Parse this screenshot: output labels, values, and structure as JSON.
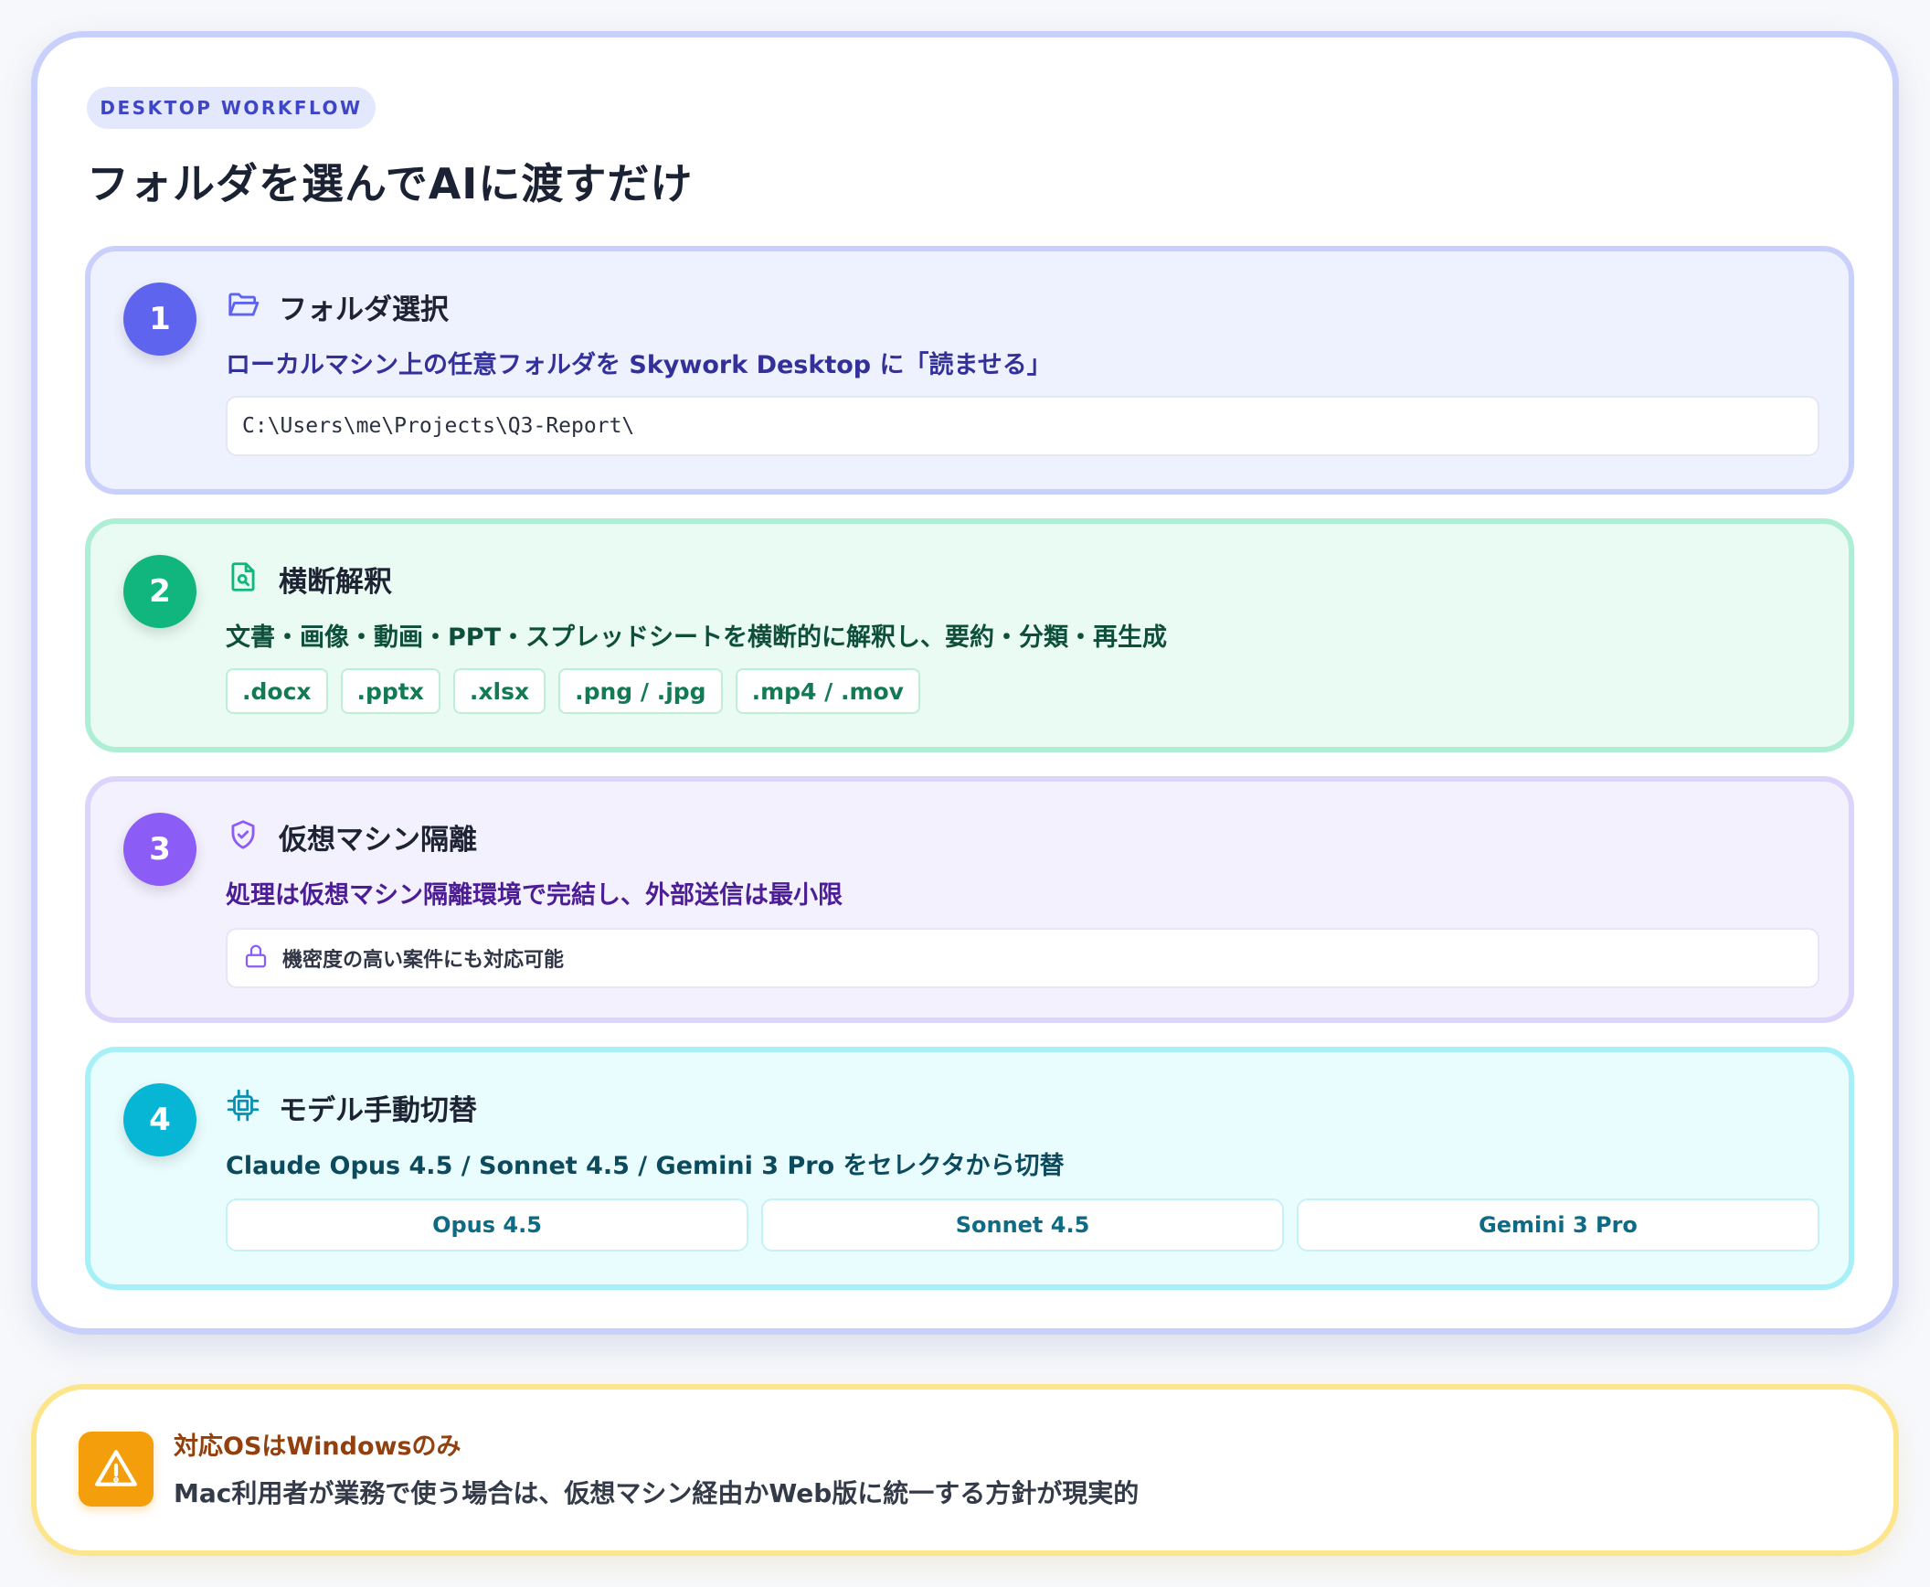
{
  "header": {
    "badge": "DESKTOP WORKFLOW",
    "title": "フォルダを選んでAIに渡すだけ"
  },
  "steps": [
    {
      "number": "1",
      "icon": "folder-open-icon",
      "title": "フォルダ選択",
      "description": "ローカルマシン上の任意フォルダを Skywork Desktop に「読ませる」",
      "path": "C:\\Users\\me\\Projects\\Q3-Report\\"
    },
    {
      "number": "2",
      "icon": "file-search-icon",
      "title": "横断解釈",
      "description": "文書・画像・動画・PPT・スプレッドシートを横断的に解釈し、要約・分類・再生成",
      "file_types": [
        ".docx",
        ".pptx",
        ".xlsx",
        ".png / .jpg",
        ".mp4 / .mov"
      ]
    },
    {
      "number": "3",
      "icon": "shield-check-icon",
      "title": "仮想マシン隔離",
      "description": "処理は仮想マシン隔離環境で完結し、外部送信は最小限",
      "note": "機密度の高い案件にも対応可能"
    },
    {
      "number": "4",
      "icon": "cpu-chip-icon",
      "title": "モデル手動切替",
      "description": "Claude Opus 4.5 / Sonnet 4.5 / Gemini 3 Pro をセレクタから切替",
      "models": [
        "Opus 4.5",
        "Sonnet 4.5",
        "Gemini 3 Pro"
      ]
    }
  ],
  "warning": {
    "icon": "warning-triangle-icon",
    "title": "対応OSはWindowsのみ",
    "body": "Mac利用者が業務で使う場合は、仮想マシン経由かWeb版に統一する方針が現実的"
  },
  "colors": {
    "step1_accent": "#5f64ee",
    "step2_accent": "#10b67d",
    "step3_accent": "#8b5cf6",
    "step4_accent": "#06b6d4",
    "warning_accent": "#f59e0b"
  }
}
